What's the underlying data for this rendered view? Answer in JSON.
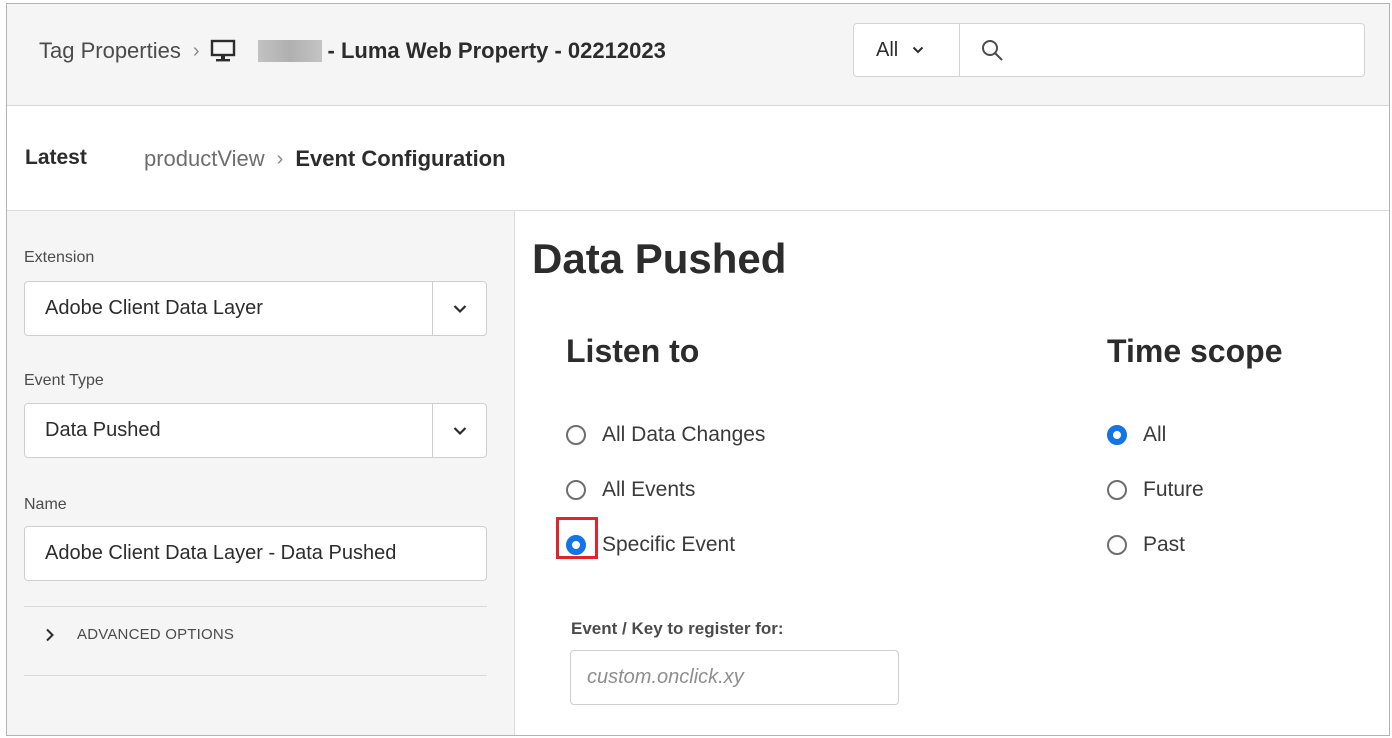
{
  "topbar": {
    "breadcrumb_root": "Tag Properties",
    "breadcrumb_sep": "›",
    "property_name": "- Luma Web Property - 02212023",
    "scope_value": "All",
    "search_placeholder": ""
  },
  "subheader": {
    "revision": "Latest",
    "rule_name": "productView",
    "sep": "›",
    "current": "Event Configuration"
  },
  "form": {
    "extension_label": "Extension",
    "extension_value": "Adobe Client Data Layer",
    "event_type_label": "Event Type",
    "event_type_value": "Data Pushed",
    "name_label": "Name",
    "name_value": "Adobe Client Data Layer - Data Pushed",
    "advanced_label": "ADVANCED OPTIONS"
  },
  "config": {
    "title": "Data Pushed",
    "listen_heading": "Listen to",
    "listen_options": [
      {
        "label": "All Data Changes",
        "selected": false
      },
      {
        "label": "All Events",
        "selected": false
      },
      {
        "label": "Specific Event",
        "selected": true
      }
    ],
    "time_heading": "Time scope",
    "time_options": [
      {
        "label": "All",
        "selected": true
      },
      {
        "label": "Future",
        "selected": false
      },
      {
        "label": "Past",
        "selected": false
      }
    ],
    "register_label": "Event / Key to register for:",
    "register_placeholder": "custom.onclick.xy",
    "register_value": ""
  },
  "colors": {
    "accent": "#1473e6",
    "highlight": "#e0242e"
  }
}
